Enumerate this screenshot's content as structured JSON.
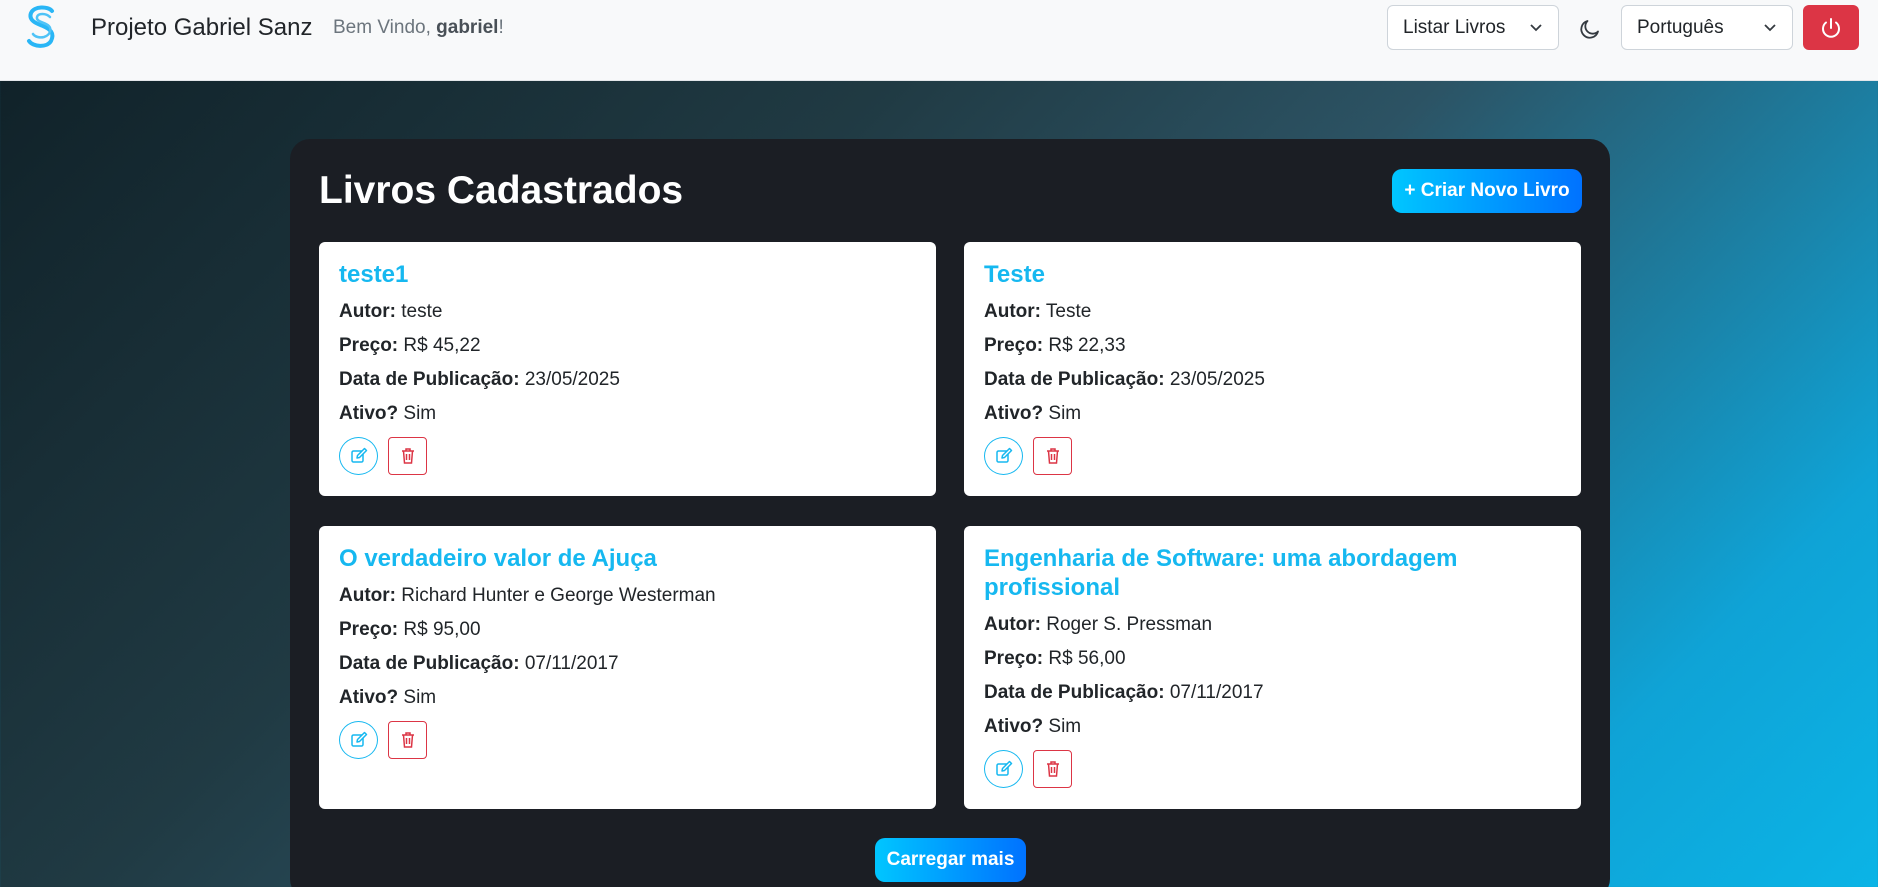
{
  "header": {
    "brand": "Projeto Gabriel Sanz",
    "welcome_prefix": "Bem Vindo, ",
    "username": "gabriel",
    "welcome_suffix": "!",
    "nav_select_value": "Listar Livros",
    "language_select_value": "Português"
  },
  "main": {
    "title": "Livros Cadastrados",
    "create_button": "+ Criar Novo Livro",
    "load_more_button": "Carregar mais",
    "labels": {
      "author": "Autor:",
      "price": "Preço:",
      "published": "Data de Publicação:",
      "active": "Ativo?"
    },
    "books": [
      {
        "title": "teste1",
        "author": "teste",
        "price": "R$ 45,22",
        "published": "23/05/2025",
        "active": "Sim"
      },
      {
        "title": "Teste",
        "author": "Teste",
        "price": "R$ 22,33",
        "published": "23/05/2025",
        "active": "Sim"
      },
      {
        "title": "O verdadeiro valor de Ajuça",
        "author": "Richard Hunter e George Westerman",
        "price": "R$ 95,00",
        "published": "07/11/2017",
        "active": "Sim"
      },
      {
        "title": "Engenharia de Software: uma abordagem profissional",
        "author": "Roger S. Pressman",
        "price": "R$ 56,00",
        "published": "07/11/2017",
        "active": "Sim"
      }
    ]
  },
  "colors": {
    "accent": "#16b8f0",
    "danger": "#dc3545",
    "panel": "#1b1e24"
  }
}
